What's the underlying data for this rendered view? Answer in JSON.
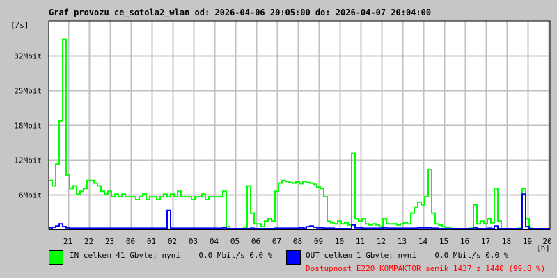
{
  "chart_data": {
    "type": "line",
    "title": "Graf provozu ce_sotola2_wlan od: 2026-04-06 20:05:00 do: 2026-04-07 20:04:00",
    "ylabel": "[/s]",
    "xlabel": "[h]",
    "start_time": "20:05",
    "sample_interval_min": 10,
    "ylim": [
      0,
      38.4
    ],
    "y_unit": "Mbit/s",
    "y_ticks": [
      {
        "value": 6.4,
        "label": "6Mbit"
      },
      {
        "value": 12.8,
        "label": "12Mbit"
      },
      {
        "value": 19.2,
        "label": "18Mbit"
      },
      {
        "value": 25.6,
        "label": "25Mbit"
      },
      {
        "value": 32,
        "label": "32Mbit"
      }
    ],
    "x_ticks": [
      "21",
      "22",
      "23",
      "00",
      "01",
      "02",
      "03",
      "04",
      "05",
      "06",
      "07",
      "08",
      "09",
      "10",
      "11",
      "12",
      "13",
      "14",
      "15",
      "16",
      "17",
      "18",
      "19",
      "20"
    ],
    "grid": true,
    "series": [
      {
        "name": "IN",
        "color": "#00ff00",
        "values": [
          9,
          8,
          12,
          20,
          35,
          10,
          7.5,
          8,
          6.5,
          7,
          7.5,
          9,
          9,
          8.5,
          8,
          7,
          6.5,
          7,
          6,
          6.5,
          6,
          6.5,
          6,
          6,
          6,
          5.5,
          6,
          6.5,
          5.5,
          6,
          6,
          5.5,
          6,
          6.5,
          6,
          6.5,
          6,
          7,
          6,
          6,
          6,
          5.5,
          6,
          6,
          6.5,
          5.5,
          6,
          6,
          6,
          6,
          7,
          0.5,
          0,
          0,
          0,
          0,
          0.3,
          8,
          3,
          1,
          1,
          0.5,
          1.5,
          2,
          1.5,
          7,
          8.5,
          9,
          8.8,
          8.6,
          8.5,
          8.7,
          8.4,
          8.8,
          8.6,
          8.5,
          8.3,
          7.8,
          7.5,
          6,
          1.5,
          1.2,
          1,
          1.5,
          1,
          1.2,
          0.8,
          14,
          2,
          1.5,
          2,
          1,
          0.8,
          1,
          0.8,
          0.5,
          2,
          1,
          1,
          1,
          0.8,
          1,
          1.2,
          1,
          3,
          4,
          5,
          4.5,
          6,
          11,
          3,
          1,
          0.8,
          0.5,
          0.3,
          0.2,
          0,
          0,
          0,
          0,
          0,
          0.2,
          4.5,
          1,
          1.5,
          1,
          2,
          1.2,
          7.5,
          1.5,
          0,
          0,
          0,
          0,
          0,
          0.2,
          7.5,
          2,
          0.2,
          0,
          0,
          0,
          0,
          0
        ]
      },
      {
        "name": "OUT",
        "color": "#0000ff",
        "values": [
          0.3,
          0.4,
          0.6,
          1,
          0.5,
          0.3,
          0.2,
          0.2,
          0.2,
          0.2,
          0.2,
          0.2,
          0.2,
          0.2,
          0.2,
          0.2,
          0.2,
          0.2,
          0.2,
          0.2,
          0.2,
          0.2,
          0.2,
          0.2,
          0.2,
          0.2,
          0.2,
          0.2,
          0.2,
          0.2,
          0.2,
          0.2,
          0.2,
          0.2,
          3.5,
          0.2,
          0.2,
          0.2,
          0.2,
          0.2,
          0.2,
          0.2,
          0.2,
          0.2,
          0.2,
          0.2,
          0.2,
          0.2,
          0.2,
          0.2,
          0.3,
          0.1,
          0,
          0,
          0,
          0,
          0,
          0.1,
          0.2,
          0.1,
          0.1,
          0.1,
          0.1,
          0.1,
          0.1,
          0.2,
          0.2,
          0.2,
          0.2,
          0.2,
          0.2,
          0.2,
          0.3,
          0.2,
          0.5,
          0.6,
          0.4,
          0.3,
          0.3,
          0.2,
          0.2,
          0.2,
          0.1,
          0.1,
          0.1,
          0.1,
          0.1,
          0.8,
          0.3,
          0.3,
          0.2,
          0.2,
          0.2,
          0.2,
          0.2,
          0.2,
          0.3,
          0.2,
          0.2,
          0.2,
          0.2,
          0.2,
          0.2,
          0.2,
          0.2,
          0.2,
          0.3,
          0.3,
          0.3,
          0.3,
          0.2,
          0.2,
          0.1,
          0.1,
          0,
          0,
          0,
          0,
          0,
          0,
          0,
          0,
          0.3,
          0.1,
          0.1,
          0.1,
          0.2,
          0.1,
          0.6,
          0.1,
          0,
          0,
          0,
          0,
          0,
          0,
          6.5,
          0.5,
          0,
          0,
          0,
          0,
          0,
          0
        ]
      }
    ]
  },
  "legend": {
    "in_text": "IN celkem 41 Gbyte; nyní    0.0 Mbit/s 0.0 %",
    "out_text": "OUT celkem 1 Gbyte; nyní    0.0 Mbit/s 0.0 %",
    "availability_text": "Dostupnost E220 KOMPAKTOR semik 1437 z 1440 (99.8 %)",
    "in_color": "#00ff00",
    "out_color": "#0000ff"
  }
}
